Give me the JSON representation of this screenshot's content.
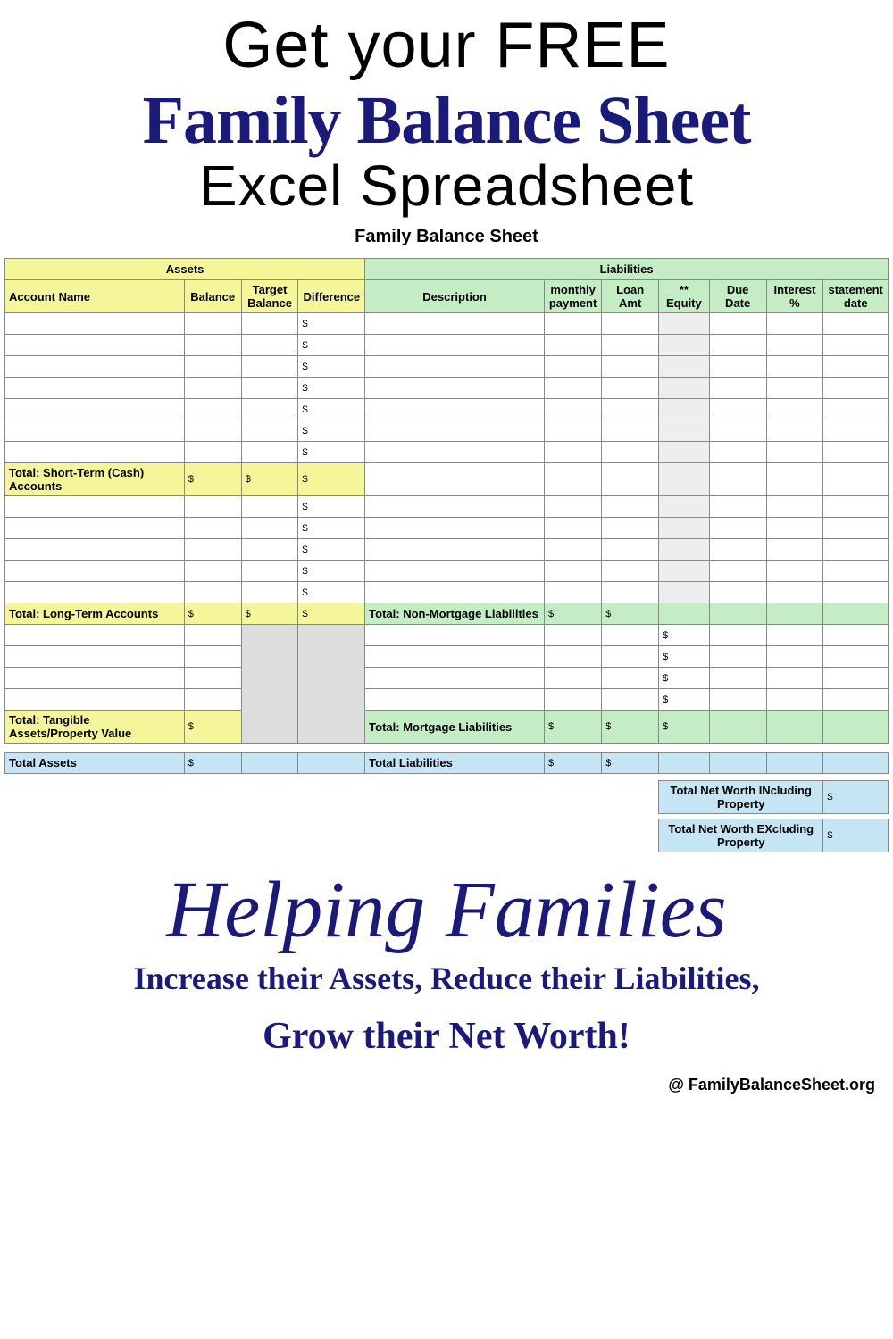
{
  "header": {
    "line1": "Get your FREE",
    "line2": "Family Balance Sheet",
    "line3": "Excel Spreadsheet"
  },
  "sheet": {
    "title": "Family Balance Sheet",
    "assets_header": "Assets",
    "liabilities_header": "Liabilities",
    "cols_assets": [
      "Account Name",
      "Balance",
      "Target Balance",
      "Difference"
    ],
    "cols_liab": [
      "Description",
      "monthly payment",
      "Loan Amt",
      "** Equity",
      "Due Date",
      "Interest %",
      "statement date"
    ],
    "totals": {
      "short_term": "Total: Short-Term (Cash) Accounts",
      "long_term": "Total: Long-Term Accounts",
      "tangible": "Total: Tangible Assets/Property Value",
      "non_mortgage": "Total: Non-Mortgage Liabilities",
      "mortgage": "Total: Mortgage Liabilities",
      "total_assets": "Total Assets",
      "total_liab": "Total Liabilities",
      "net_inc": "Total Net Worth INcluding Property",
      "net_exc": "Total Net Worth EXcluding Property"
    },
    "dollar": "$",
    "dash": "-"
  },
  "footer": {
    "script": "Helping Families",
    "line1": "Increase their Assets, Reduce their Liabilities,",
    "line2": "Grow their Net Worth!",
    "credit": "@ FamilyBalanceSheet.org"
  }
}
